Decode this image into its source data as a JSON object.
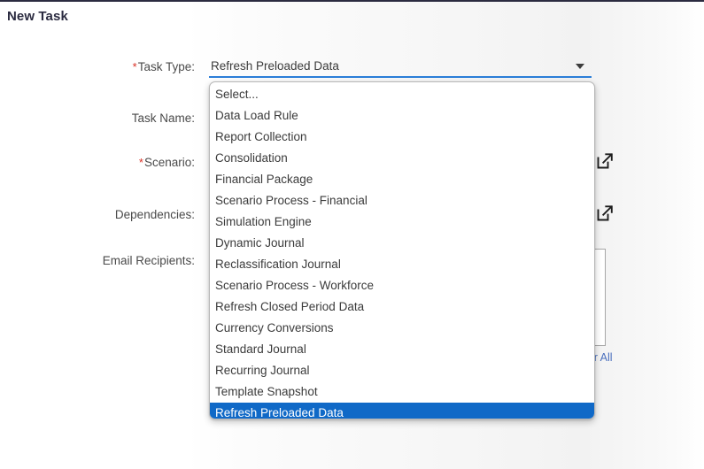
{
  "page": {
    "title": "New Task"
  },
  "form": {
    "rows": [
      {
        "label": "Task Type:",
        "required": true,
        "control": "combobox",
        "value": "Refresh Preloaded Data",
        "caret_icon": "chevron-down-icon"
      },
      {
        "label": "Task Name:",
        "required": false,
        "control": "text",
        "value": "",
        "placeholder": ""
      },
      {
        "label": "Scenario:",
        "required": true,
        "control": "text-with-launch",
        "value": "",
        "placeholder": "",
        "launch_icon": "external-link-icon"
      },
      {
        "label": "Dependencies:",
        "required": false,
        "control": "text-with-launch",
        "value": "",
        "placeholder": "",
        "launch_icon": "external-link-icon"
      },
      {
        "label": "Email Recipients:",
        "required": false,
        "control": "textarea",
        "value": "",
        "placeholder": "",
        "clear_all_label": "Clear All"
      }
    ]
  },
  "dropdown": {
    "open": true,
    "selected": "Refresh Preloaded Data",
    "options": [
      "Select...",
      "Data Load Rule",
      "Report Collection",
      "Consolidation",
      "Financial Package",
      "Scenario Process - Financial",
      "Simulation Engine",
      "Dynamic Journal",
      "Reclassification Journal",
      "Scenario Process - Workforce",
      "Refresh Closed Period Data",
      "Currency Conversions",
      "Standard Journal",
      "Recurring Journal",
      "Template Snapshot",
      "Refresh Preloaded Data"
    ]
  },
  "colors": {
    "highlight": "#1069c7",
    "focus_underline": "#2b7ed8",
    "required_star": "#d93025",
    "title": "#2b2b40",
    "link": "#4a6fbd"
  }
}
